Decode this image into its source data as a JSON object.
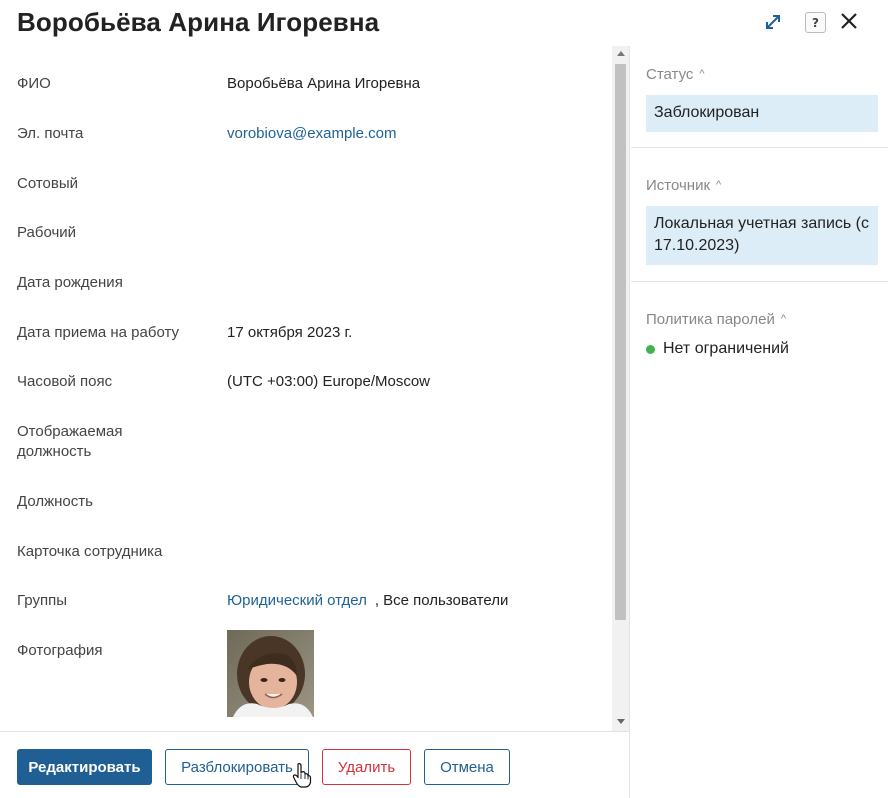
{
  "header": {
    "title": "Воробьёва Арина Игоревна",
    "help_label": "?"
  },
  "fields": {
    "fio": {
      "label": "ФИО",
      "value": "Воробьёва Арина Игоревна"
    },
    "email": {
      "label": "Эл. почта",
      "value": "vorobiova@example.com"
    },
    "mobile": {
      "label": "Сотовый",
      "value": ""
    },
    "work": {
      "label": "Рабочий",
      "value": ""
    },
    "birth": {
      "label": "Дата рождения",
      "value": ""
    },
    "hire": {
      "label": "Дата приема на работу",
      "value": "17 октября 2023 г."
    },
    "tz": {
      "label": "Часовой пояс",
      "value": "(UTC +03:00) Europe/Moscow"
    },
    "display_position": {
      "label": "Отображаемая должность",
      "value": ""
    },
    "position": {
      "label": "Должность",
      "value": ""
    },
    "card": {
      "label": "Карточка сотрудника",
      "value": ""
    },
    "groups": {
      "label": "Группы",
      "group_link": "Юридический отдел",
      "separator": ",",
      "group_other": "Все пользователи"
    },
    "photo": {
      "label": "Фотография"
    }
  },
  "footer": {
    "edit": "Редактировать",
    "unblock": "Разблокировать",
    "delete": "Удалить",
    "cancel": "Отмена"
  },
  "sidebar": {
    "status": {
      "title": "Статус",
      "value": "Заблокирован"
    },
    "source": {
      "title": "Источник",
      "value": "Локальная учетная запись (с 17.10.2023)"
    },
    "policy": {
      "title": "Политика паролей",
      "value": "Нет ограничений"
    }
  },
  "colors": {
    "primary": "#1f5f93",
    "link": "#1f6296",
    "danger": "#d6303a",
    "info_bg": "#dcedf7",
    "ok_dot": "#3fb34f"
  }
}
